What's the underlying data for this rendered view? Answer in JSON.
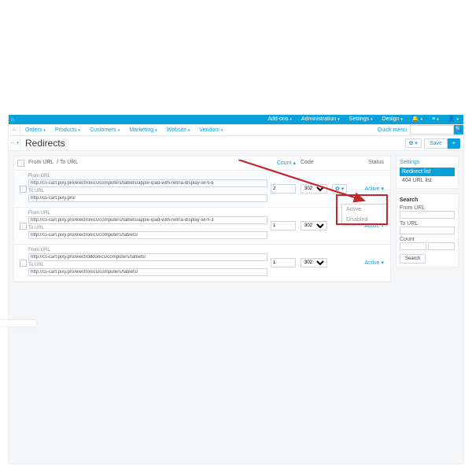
{
  "topnav": {
    "items": [
      "Add-ons",
      "Administration",
      "Settings",
      "Design"
    ],
    "icons": [
      "bell-icon",
      "bars-icon",
      "user-icon"
    ]
  },
  "nav2": {
    "items": [
      "Orders",
      "Products",
      "Customers",
      "Marketing",
      "Website",
      "Vendors"
    ],
    "quick_menu": "Quick menu"
  },
  "title": "Redirects",
  "toolbar": {
    "save": "Save",
    "plus": "+"
  },
  "columns": {
    "from": "From URL",
    "to": "/ To URL",
    "count": "Count",
    "code": "Code",
    "status": "Status"
  },
  "labels": {
    "from": "From URL",
    "to": "To URL"
  },
  "rows": [
    {
      "from": "http://cs-cart.pixy.pro/electronics/computers/tablets/apple-ipad-with-retina-display-wi-fi-6",
      "to": "http://cs-cart.pixy.pro/",
      "count": "2",
      "code": "302",
      "status": "Active",
      "gear": true,
      "alt": true
    },
    {
      "from": "http://cs-cart.pixy.pro/electronics/computers/tablets/apple-ipad-with-retina-display-wi-fi-3",
      "to": "http://cs-cart.pixy.pro/electronics/computers/tablets/",
      "count": "1",
      "code": "302",
      "status": "Active",
      "gear": false,
      "alt": false
    },
    {
      "from": "http://cs-cart.pixy.pro/electrdddonics/computers/tablets/",
      "to": "http://cs-cart.pixy.pro/electronics/computers/tablets/",
      "count": "1",
      "code": "302",
      "status": "Active",
      "gear": false,
      "alt": false
    }
  ],
  "status_menu": {
    "active": "Active",
    "disabled": "Disabled"
  },
  "side": {
    "settings": "Settings",
    "links": [
      "Redirect list",
      "404 URL list"
    ],
    "search": {
      "title": "Search",
      "from": "From URL",
      "to": "To URL",
      "count": "Count",
      "button": "Search"
    }
  },
  "caret": "▾",
  "sort_caret": "▴"
}
